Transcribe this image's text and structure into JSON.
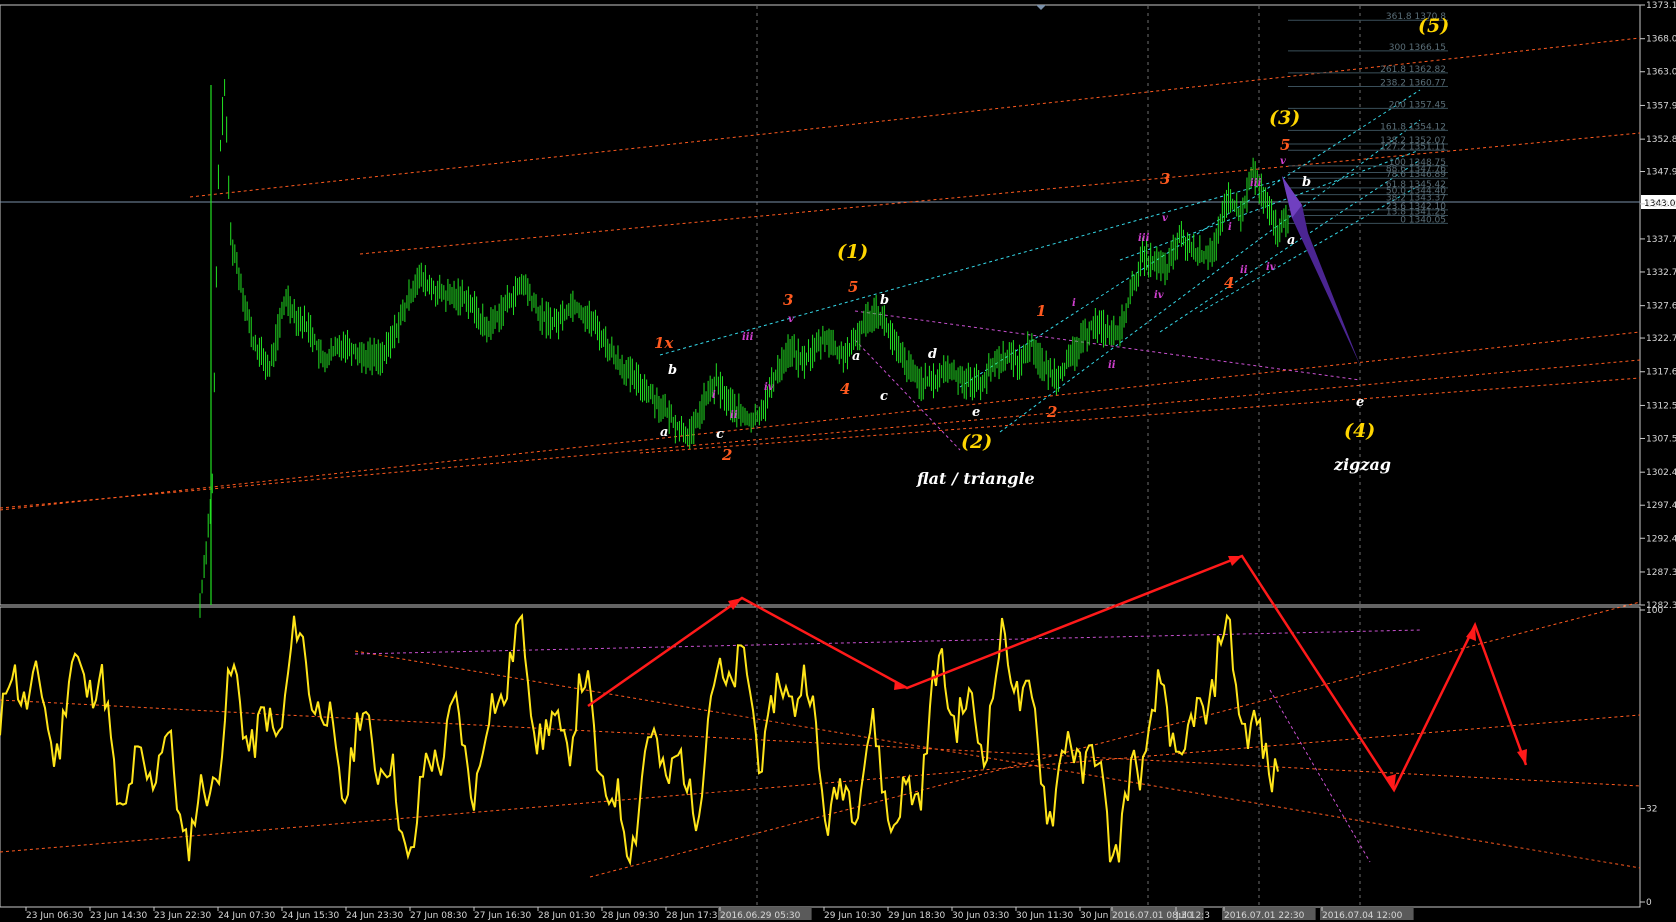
{
  "chart_data": [
    {
      "type": "candlestick",
      "symbol_hint": "price",
      "ylim": [
        1282.3,
        1373.1
      ],
      "y_ticks": [
        "1373.1",
        "1368.0",
        "1363.0",
        "1357.9",
        "1352.8",
        "1347.9",
        "1343.0",
        "1337.7",
        "1332.7",
        "1327.6",
        "1322.7",
        "1317.6",
        "1312.5",
        "1307.5",
        "1302.4",
        "1297.4",
        "1292.4",
        "1287.3",
        "1282.3"
      ],
      "current_price_label": "1343.0",
      "x_ticks": [
        "23 Jun 06:30",
        "23 Jun 14:30",
        "23 Jun 22:30",
        "24 Jun 07:30",
        "24 Jun 15:30",
        "24 Jun 23:30",
        "27 Jun 08:30",
        "27 Jun 16:30",
        "28 Jun 01:30",
        "28 Jun 09:30",
        "28 Jun 17:30",
        "2016.06.29 05:30",
        "29 Jun 10:30",
        "29 Jun 18:30",
        "30 Jun 03:30",
        "30 Jun 11:30",
        "30 Jun 19:30",
        "2016.07.01 08:30",
        "Jul 12:3",
        "2016.07.01 22:30",
        "2016.07.04 12:00"
      ],
      "close_path": [
        [
          0,
          1282.3
        ],
        [
          6,
          1300
        ],
        [
          9,
          1347
        ],
        [
          12,
          1361
        ],
        [
          15,
          1338
        ],
        [
          20,
          1331
        ],
        [
          26,
          1322
        ],
        [
          34,
          1318
        ],
        [
          42,
          1329
        ],
        [
          47,
          1326
        ],
        [
          54,
          1324
        ],
        [
          60,
          1319
        ],
        [
          70,
          1322
        ],
        [
          80,
          1320
        ],
        [
          90,
          1320
        ],
        [
          100,
          1327
        ],
        [
          106,
          1332
        ],
        [
          114,
          1330
        ],
        [
          120,
          1329
        ],
        [
          130,
          1329
        ],
        [
          140,
          1324
        ],
        [
          150,
          1328
        ],
        [
          158,
          1331
        ],
        [
          166,
          1326
        ],
        [
          174,
          1325
        ],
        [
          182,
          1328
        ],
        [
          192,
          1325
        ],
        [
          202,
          1320
        ],
        [
          210,
          1317
        ],
        [
          218,
          1315
        ],
        [
          226,
          1312
        ],
        [
          234,
          1309
        ],
        [
          240,
          1308
        ],
        [
          246,
          1313
        ],
        [
          252,
          1316
        ],
        [
          258,
          1313
        ],
        [
          264,
          1311
        ],
        [
          270,
          1310
        ],
        [
          276,
          1313
        ],
        [
          282,
          1318
        ],
        [
          288,
          1321
        ],
        [
          294,
          1319
        ],
        [
          300,
          1321
        ],
        [
          306,
          1323
        ],
        [
          312,
          1320
        ],
        [
          318,
          1321
        ],
        [
          324,
          1325
        ],
        [
          330,
          1327
        ],
        [
          336,
          1324
        ],
        [
          340,
          1321
        ],
        [
          346,
          1318
        ],
        [
          352,
          1316
        ],
        [
          358,
          1316
        ],
        [
          364,
          1318
        ],
        [
          370,
          1317
        ],
        [
          376,
          1316
        ],
        [
          382,
          1316
        ],
        [
          388,
          1319
        ],
        [
          394,
          1320
        ],
        [
          400,
          1319
        ],
        [
          406,
          1322
        ],
        [
          412,
          1318
        ],
        [
          418,
          1317
        ],
        [
          424,
          1319
        ],
        [
          430,
          1322
        ],
        [
          436,
          1325
        ],
        [
          442,
          1324
        ],
        [
          448,
          1323
        ],
        [
          454,
          1329
        ],
        [
          460,
          1335
        ],
        [
          466,
          1334
        ],
        [
          472,
          1333
        ],
        [
          478,
          1338
        ],
        [
          484,
          1336
        ],
        [
          490,
          1335
        ],
        [
          496,
          1337
        ],
        [
          502,
          1344
        ],
        [
          508,
          1341
        ],
        [
          514,
          1348
        ],
        [
          520,
          1343
        ],
        [
          526,
          1339
        ],
        [
          532,
          1341
        ]
      ],
      "wave_labels": [
        {
          "text": "(1)",
          "x_hint": "29 Jun 10:30",
          "color": "#ffd600"
        },
        {
          "text": "(2)",
          "x_hint": "30 Jun 03:30",
          "color": "#ffd600"
        },
        {
          "text": "(3)",
          "x_hint": "2016.07.01 22:30",
          "color": "#ffd600"
        },
        {
          "text": "(4)",
          "x_hint": "2016.07.04 12:00",
          "color": "#ffd600"
        },
        {
          "text": "(5)",
          "x_hint": "right",
          "color": "#ffd600"
        }
      ],
      "annotations": [
        "flat / triangle",
        "zigzag"
      ],
      "fib_levels": [
        {
          "ratio": "361.8",
          "price": "1370.8"
        },
        {
          "ratio": "300",
          "price": "1366.15"
        },
        {
          "ratio": "261.8",
          "price": "1362.82"
        },
        {
          "ratio": "238.2",
          "price": "1360.77"
        },
        {
          "ratio": "200",
          "price": "1357.45"
        },
        {
          "ratio": "161.8",
          "price": "1354.12"
        },
        {
          "ratio": "138.2",
          "price": "1352.07"
        },
        {
          "ratio": "127.2",
          "price": "1351.11"
        },
        {
          "ratio": "100",
          "price": "1348.75"
        },
        {
          "ratio": "88.6",
          "price": "1347.76"
        },
        {
          "ratio": "78.6",
          "price": "1346.89"
        },
        {
          "ratio": "61.8",
          "price": "1345.42"
        },
        {
          "ratio": "50.0",
          "price": "1344.40"
        },
        {
          "ratio": "38.2",
          "price": "1343.37"
        },
        {
          "ratio": "23.6",
          "price": "1342.10"
        },
        {
          "ratio": "13.8",
          "price": "1341.25"
        },
        {
          "ratio": "0",
          "price": "1340.05"
        }
      ]
    },
    {
      "type": "line",
      "name_hint": "oscillator",
      "ylim": [
        0,
        100
      ],
      "y_ticks": [
        "100",
        "32",
        "0"
      ]
    }
  ],
  "labels": {
    "main_wave": [
      "1x",
      "2",
      "3",
      "4",
      "5",
      "1",
      "2",
      "3",
      "4",
      "5"
    ],
    "sub_wave": [
      "a",
      "b",
      "c",
      "d",
      "e"
    ],
    "minor_wave": [
      "i",
      "ii",
      "iii",
      "iv",
      "v"
    ]
  }
}
